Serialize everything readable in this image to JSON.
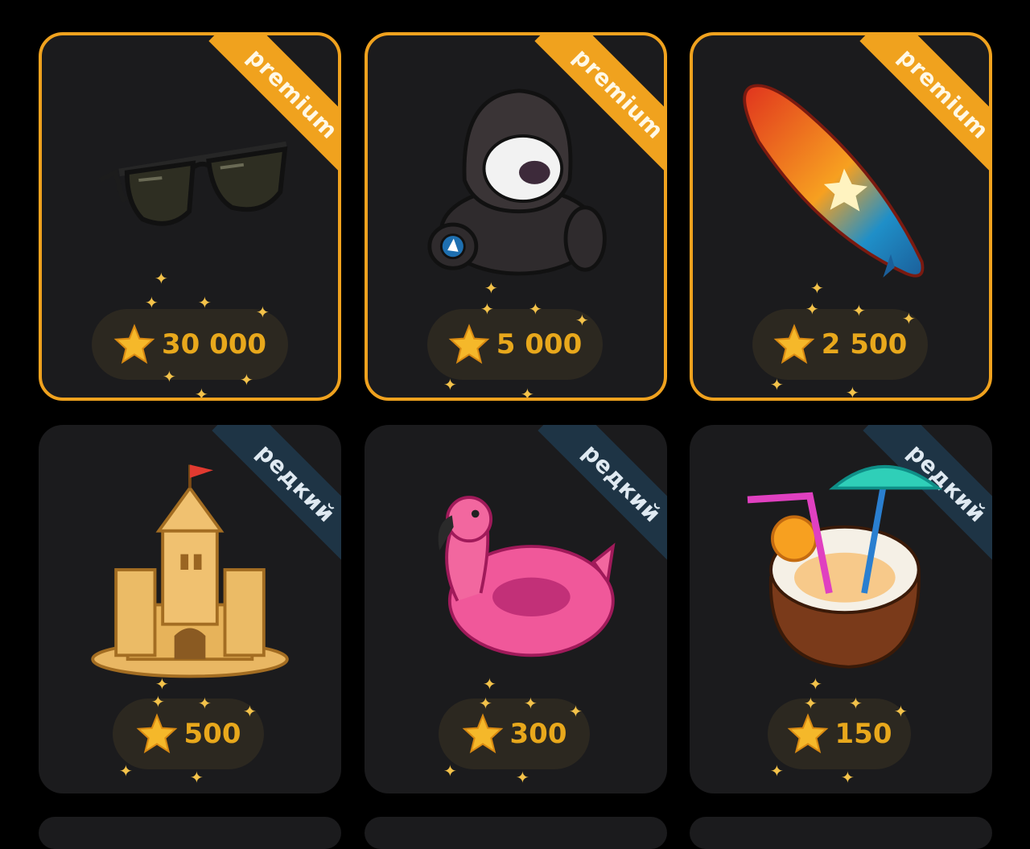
{
  "colors": {
    "background": "#000000",
    "card": "#1b1b1d",
    "premium_accent": "#f0a21e",
    "rare_ribbon": "#1e3445",
    "price_text": "#e8a81c",
    "price_pill": "#2c2820"
  },
  "gifts": [
    {
      "tier": "premium",
      "ribbon": "premium",
      "icon": "sunglasses-icon",
      "price": "30 000"
    },
    {
      "tier": "premium",
      "ribbon": "premium",
      "icon": "hooded-plush-bear-icon",
      "price": "5 000"
    },
    {
      "tier": "premium",
      "ribbon": "premium",
      "icon": "surfboard-icon",
      "price": "2 500"
    },
    {
      "tier": "rare",
      "ribbon": "редкий",
      "icon": "sand-castle-icon",
      "price": "500"
    },
    {
      "tier": "rare",
      "ribbon": "редкий",
      "icon": "flamingo-float-icon",
      "price": "300"
    },
    {
      "tier": "rare",
      "ribbon": "редкий",
      "icon": "coconut-cocktail-icon",
      "price": "150"
    }
  ]
}
